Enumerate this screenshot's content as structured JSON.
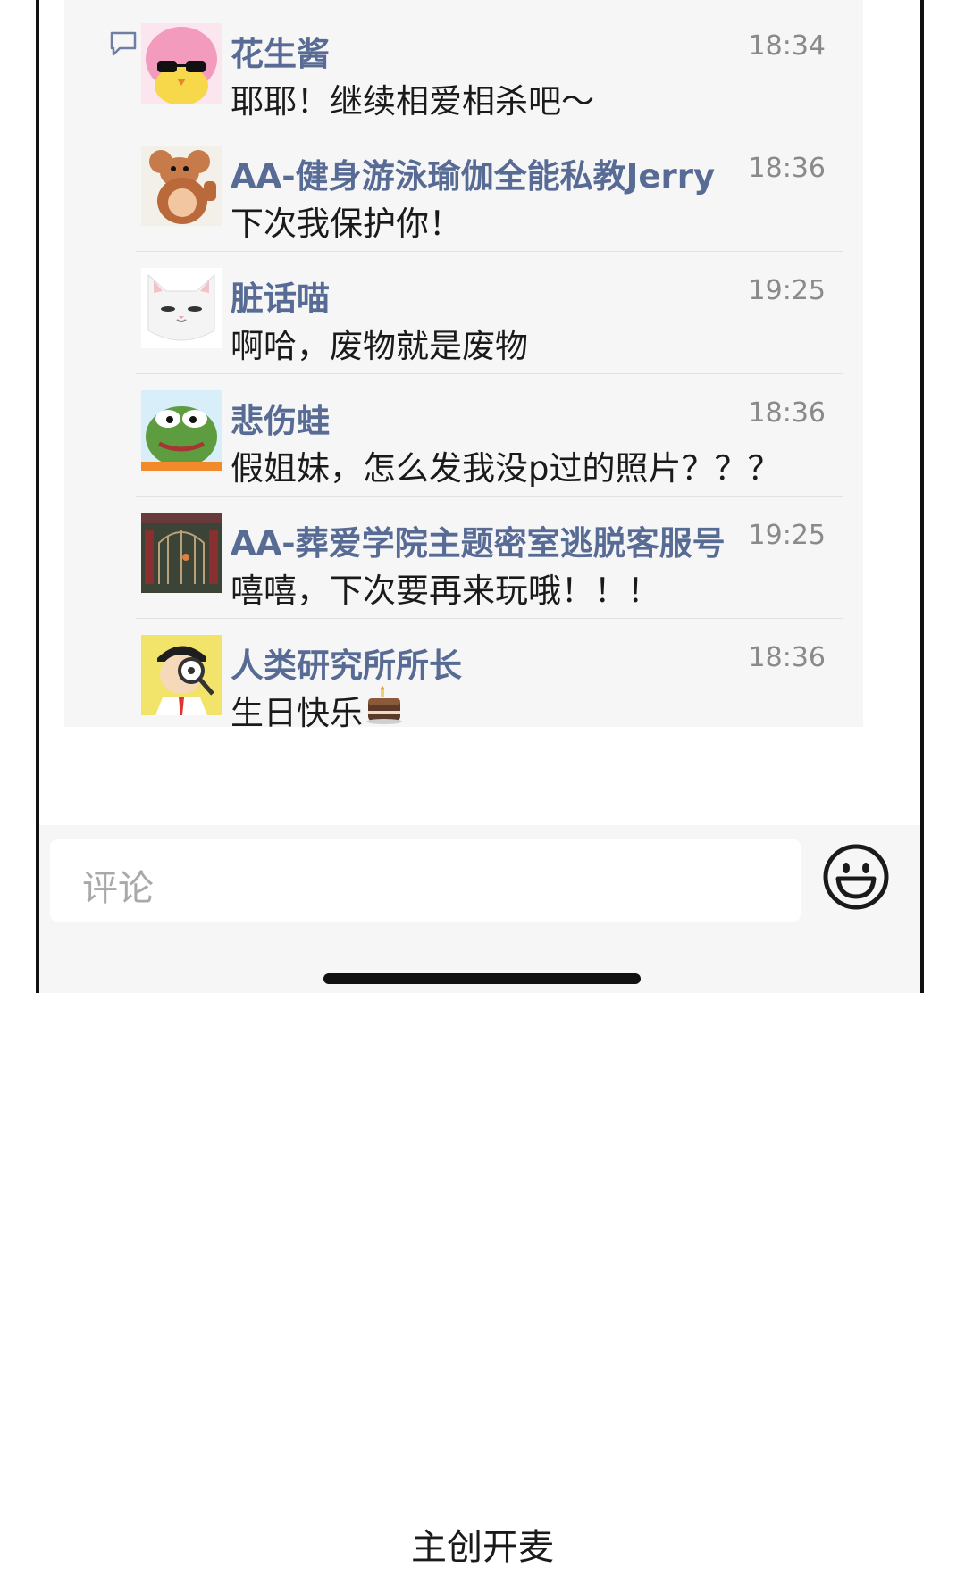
{
  "comments": [
    {
      "name": "花生酱",
      "time": "18:34",
      "text": "耶耶！继续相爱相杀吧～",
      "avatar": "pink-hair-chick-avatar"
    },
    {
      "name": "AA-健身游泳瑜伽全能私教Jerry",
      "time": "18:36",
      "text": "下次我保护你！",
      "avatar": "jerry-mouse-avatar"
    },
    {
      "name": "脏话喵",
      "time": "19:25",
      "text": "啊哈，废物就是废物",
      "avatar": "white-cat-avatar"
    },
    {
      "name": "悲伤蛙",
      "time": "18:36",
      "text": "假姐妹，怎么发我没p过的照片？？？",
      "avatar": "pepe-frog-avatar"
    },
    {
      "name": "AA-葬爱学院主题密室逃脱客服号",
      "time": "19:25",
      "text": "嘻嘻，下次要再来玩哦！！！",
      "avatar": "iron-gate-avatar"
    },
    {
      "name": "人类研究所所长",
      "time": "18:36",
      "text": "生日快乐",
      "avatar": "magnifier-scientist-avatar",
      "emoji": "cake-emoji"
    }
  ],
  "input": {
    "placeholder": "评论",
    "icon": "smiley-icon"
  },
  "side_icon": "comment-bubble-icon",
  "footer": {
    "caption": "主创开麦"
  },
  "colors": {
    "name": "#576b95",
    "panel": "#f6f6f6",
    "time": "#8a8a8a"
  }
}
